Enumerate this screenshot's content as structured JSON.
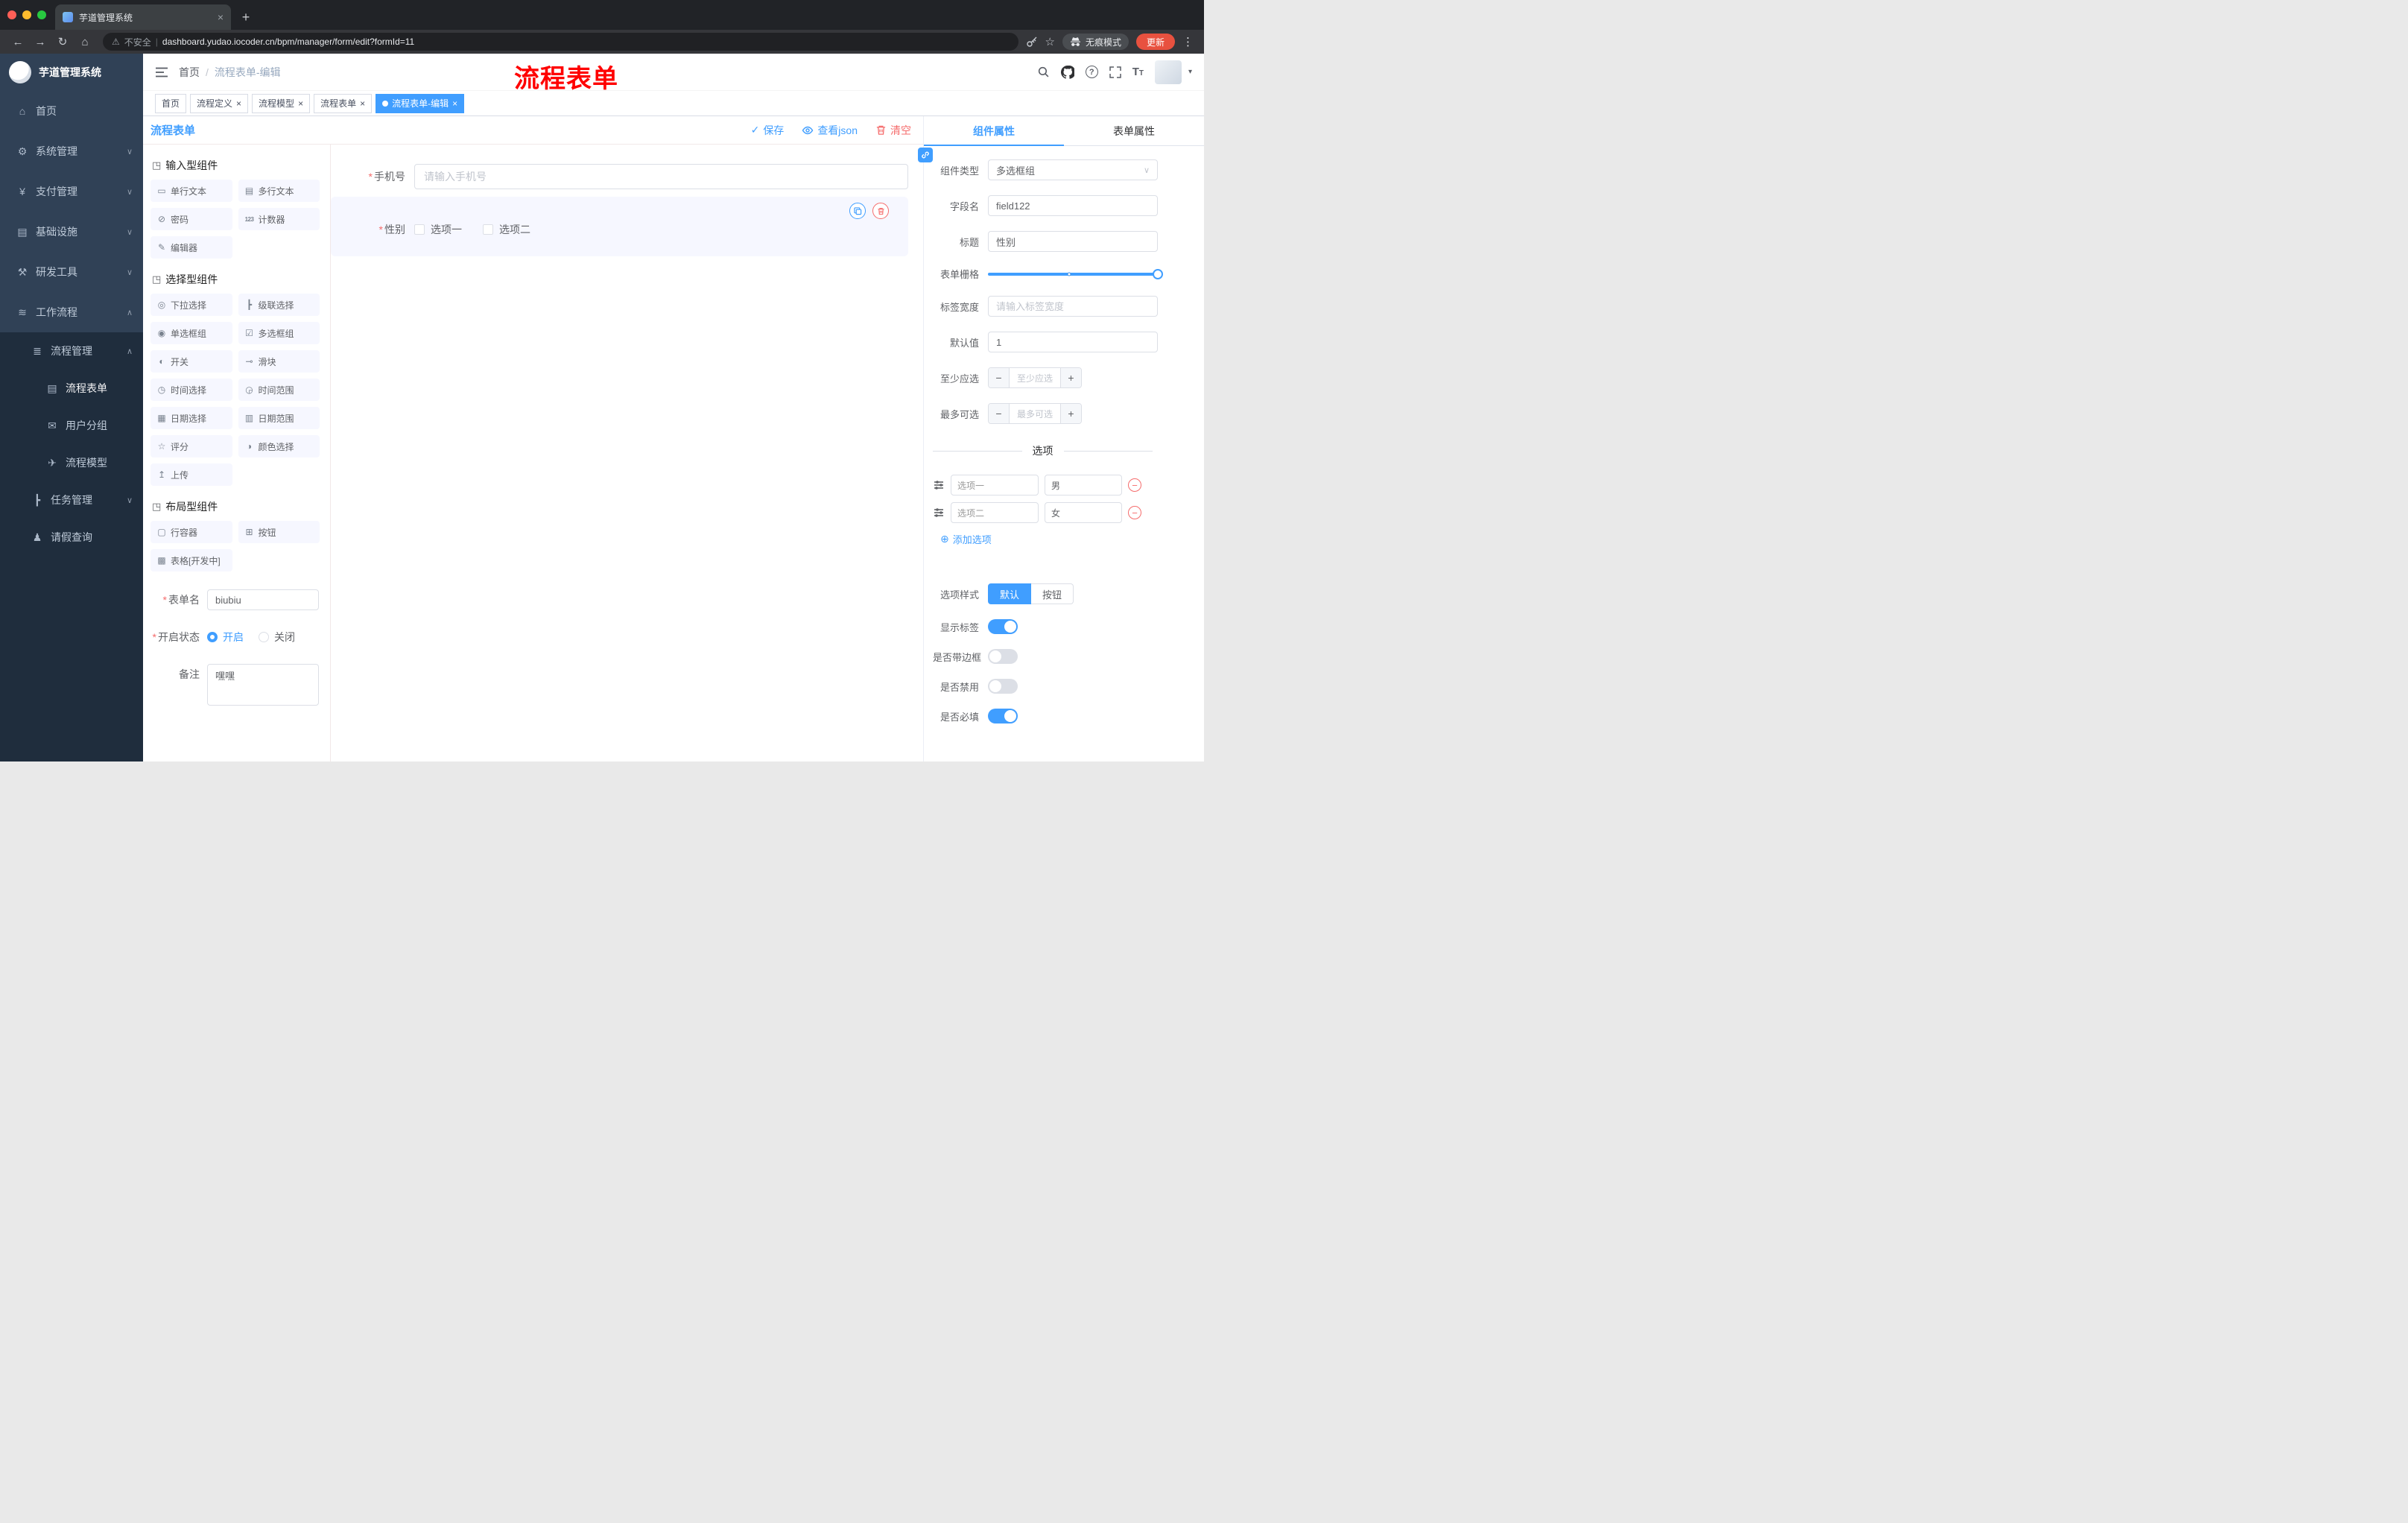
{
  "browser": {
    "tab_title": "芋道管理系统",
    "security_label": "不安全",
    "url": "dashboard.yudao.iocoder.cn/bpm/manager/form/edit?formId=11",
    "incognito_label": "无痕模式",
    "update_label": "更新"
  },
  "sidebar": {
    "logo_title": "芋道管理系统",
    "items": [
      {
        "label": "首页"
      },
      {
        "label": "系统管理"
      },
      {
        "label": "支付管理"
      },
      {
        "label": "基础设施"
      },
      {
        "label": "研发工具"
      },
      {
        "label": "工作流程"
      },
      {
        "label": "流程管理"
      },
      {
        "label": "流程表单"
      },
      {
        "label": "用户分组"
      },
      {
        "label": "流程模型"
      },
      {
        "label": "任务管理"
      },
      {
        "label": "请假查询"
      }
    ]
  },
  "header": {
    "breadcrumb_home": "首页",
    "breadcrumb_sep": "/",
    "breadcrumb_current": "流程表单-编辑",
    "annotation": "流程表单"
  },
  "tags": [
    {
      "label": "首页"
    },
    {
      "label": "流程定义"
    },
    {
      "label": "流程模型"
    },
    {
      "label": "流程表单"
    },
    {
      "label": "流程表单-编辑"
    }
  ],
  "content": {
    "form_title": "流程表单",
    "actions": {
      "save": "保存",
      "view_json": "查看json",
      "clear": "清空"
    }
  },
  "palette": {
    "groups": [
      {
        "title": "输入型组件",
        "items": [
          "单行文本",
          "多行文本",
          "密码",
          "计数器",
          "编辑器"
        ]
      },
      {
        "title": "选择型组件",
        "items": [
          "下拉选择",
          "级联选择",
          "单选框组",
          "多选框组",
          "开关",
          "滑块",
          "时间选择",
          "时间范围",
          "日期选择",
          "日期范围",
          "评分",
          "颜色选择",
          "上传"
        ]
      },
      {
        "title": "布局型组件",
        "items": [
          "行容器",
          "按钮",
          "表格[开发中]"
        ]
      }
    ],
    "meta": {
      "name_label": "表单名",
      "name_value": "biubiu",
      "status_label": "开启状态",
      "status_on": "开启",
      "status_off": "关闭",
      "remark_label": "备注",
      "remark_value": "嘿嘿"
    }
  },
  "canvas": {
    "phone": {
      "label": "手机号",
      "placeholder": "请输入手机号"
    },
    "gender": {
      "label": "性别",
      "option1": "选项一",
      "option2": "选项二"
    }
  },
  "props": {
    "tab_component": "组件属性",
    "tab_form": "表单属性",
    "component_type_label": "组件类型",
    "component_type_value": "多选框组",
    "field_label": "字段名",
    "field_value": "field122",
    "title_label": "标题",
    "title_value": "性别",
    "grid_label": "表单栅格",
    "label_width_label": "标签宽度",
    "label_width_placeholder": "请输入标签宽度",
    "default_label": "默认值",
    "default_value": "1",
    "min_label": "至少应选",
    "min_placeholder": "至少应选",
    "max_label": "最多可选",
    "max_placeholder": "最多可选",
    "options_title": "选项",
    "options": [
      {
        "label": "选项一",
        "value": "男"
      },
      {
        "label": "选项二",
        "value": "女"
      }
    ],
    "add_option": "添加选项",
    "style_label": "选项样式",
    "style_default": "默认",
    "style_button": "按钮",
    "switch_show_label": "显示标签",
    "switch_border": "是否带边框",
    "switch_disabled": "是否禁用",
    "switch_required": "是否必填"
  },
  "icons": {
    "back": "←",
    "forward": "→",
    "reload": "↻",
    "home": "⌂",
    "warning": "⚠",
    "divider": "|",
    "star": "☆",
    "dots": "⋮",
    "plus": "+",
    "close": "×",
    "check": "✓",
    "caret": "▾",
    "select_arrow": "∨",
    "required": "*",
    "minus": "−",
    "plus_sign": "+",
    "circle_plus": "⊕",
    "chev_down": "∨",
    "chev_up": "∧",
    "menu_home": "⌂",
    "menu_system": "⚙",
    "menu_pay": "¥",
    "menu_infra": "▤",
    "menu_dev": "⚒",
    "menu_flow": "≋",
    "menu_flowmgr": "≣",
    "menu_form": "▤",
    "menu_group": "✉",
    "menu_model": "✈",
    "menu_task": "┣",
    "menu_leave": "♟",
    "p_group": "◳",
    "p_single": "▭",
    "p_multi": "▤",
    "p_password": "⊘",
    "p_counter": "123",
    "p_editor": "✎",
    "p_select": "◎",
    "p_cascader": "┣",
    "p_radio": "◉",
    "p_checkbox": "☑",
    "p_switch": "◐",
    "p_slider": "⊸",
    "p_time": "◷",
    "p_timerange": "◶",
    "p_date": "▦",
    "p_daterange": "▥",
    "p_rate": "☆",
    "p_color": "◑",
    "p_upload": "↥",
    "p_row": "▢",
    "p_button": "⊞",
    "p_table": "▩"
  },
  "colors": {
    "primary": "#409EFF",
    "danger": "#F56C6C",
    "sidebar": "#304156",
    "annotation": "#FF0000"
  }
}
